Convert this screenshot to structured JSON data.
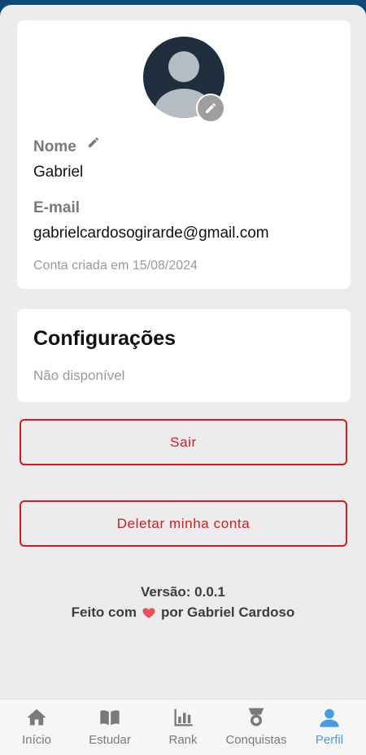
{
  "profile": {
    "name_label": "Nome",
    "name_value": "Gabriel",
    "email_label": "E-mail",
    "email_value": "gabrielcardosogirarde@gmail.com",
    "created_text": "Conta criada em 15/08/2024"
  },
  "settings": {
    "title": "Configurações",
    "status": "Não disponível"
  },
  "actions": {
    "logout_label": "Sair",
    "delete_label": "Deletar minha conta"
  },
  "footer": {
    "version_text": "Versão: 0.0.1",
    "made_prefix": "Feito com",
    "made_suffix": "por Gabriel Cardoso"
  },
  "nav": {
    "items": [
      {
        "label": "Início",
        "icon": "home-icon"
      },
      {
        "label": "Estudar",
        "icon": "book-icon"
      },
      {
        "label": "Rank",
        "icon": "bar-chart-icon"
      },
      {
        "label": "Conquistas",
        "icon": "medal-icon"
      },
      {
        "label": "Perfil",
        "icon": "person-icon"
      }
    ],
    "active_index": 4
  },
  "colors": {
    "accent": "#4a9be6",
    "danger": "#d8191d",
    "background": "#ececec",
    "avatar": "#1f2d3c"
  }
}
